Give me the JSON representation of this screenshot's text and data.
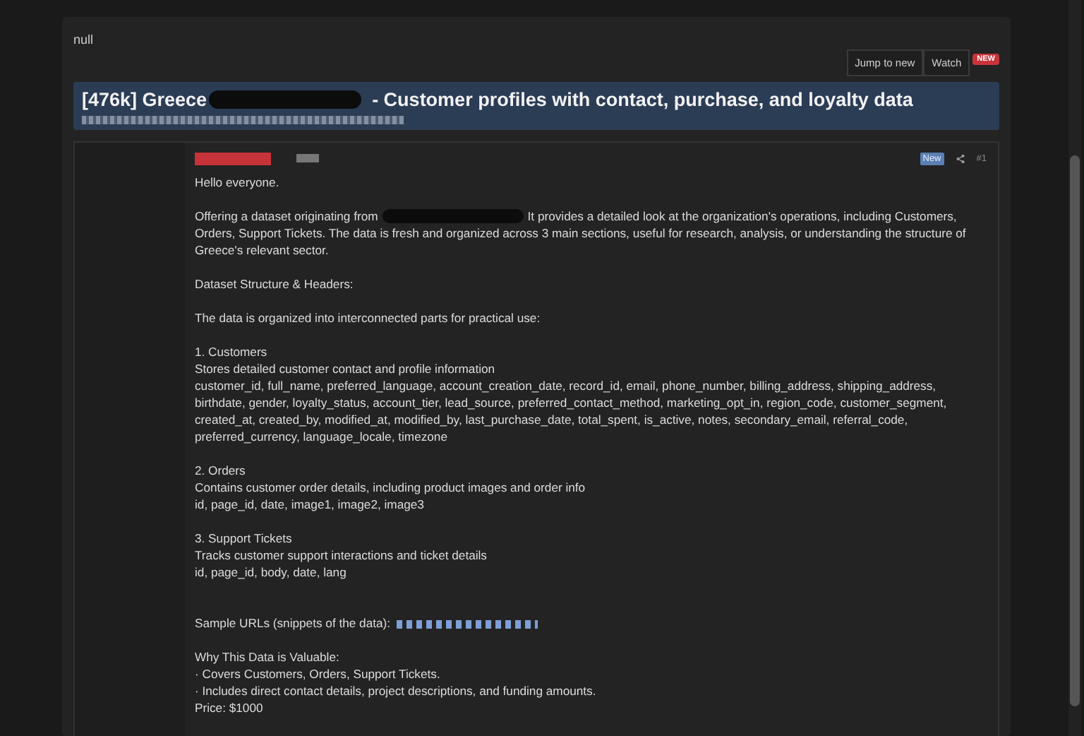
{
  "thread": {
    "label": "null"
  },
  "actions": [
    {
      "label": "Jump to new",
      "kind": "button"
    },
    {
      "label": "Watch",
      "kind": "button"
    },
    {
      "label": "NEW",
      "kind": "badge"
    }
  ],
  "title": {
    "before": "[476k] Greece",
    "after": "- Customer profiles with contact, purchase, and loyalty data"
  },
  "post": {
    "badge": "New",
    "number": "#1",
    "blocks": [
      {
        "kind": "text",
        "text": "Hello everyone."
      },
      {
        "kind": "redacted",
        "before": "Offering a dataset originating from",
        "after": "It provides a detailed look at the organization's operations, including Customers,",
        "continued": "Orders, Support Tickets. The data is fresh and organized across 3 main sections, useful for research, analysis, or understanding the structure of Greece's relevant sector."
      },
      {
        "kind": "text",
        "text": "Dataset Structure & Headers:"
      },
      {
        "kind": "text",
        "text": "The data is organized into interconnected parts for practical use:"
      },
      {
        "kind": "text",
        "text": "1. Customers\nStores detailed customer contact and profile information\ncustomer_id, full_name, preferred_language, account_creation_date, record_id, email, phone_number, billing_address, shipping_address, birthdate, gender, loyalty_status, account_tier, lead_source, preferred_contact_method, marketing_opt_in, region_code, customer_segment, created_at, created_by, modified_at, modified_by, last_purchase_date, total_spent, is_active, notes, secondary_email, referral_code, preferred_currency, language_locale, timezone"
      },
      {
        "kind": "text",
        "text": "2. Orders\nContains customer order details, including product images and order info\nid, page_id, date, image1, image2, image3"
      },
      {
        "kind": "text",
        "text": "3. Support Tickets\nTracks customer support interactions and ticket details\nid, page_id, body, date, lang"
      },
      {
        "kind": "link",
        "text": "Sample URLs (snippets of the data):"
      },
      {
        "kind": "text",
        "text": "Why This Data is Valuable:\n· Covers Customers, Orders, Support Tickets.\n· Includes direct contact details, project descriptions, and funding amounts.\nPrice: $1000"
      }
    ]
  }
}
